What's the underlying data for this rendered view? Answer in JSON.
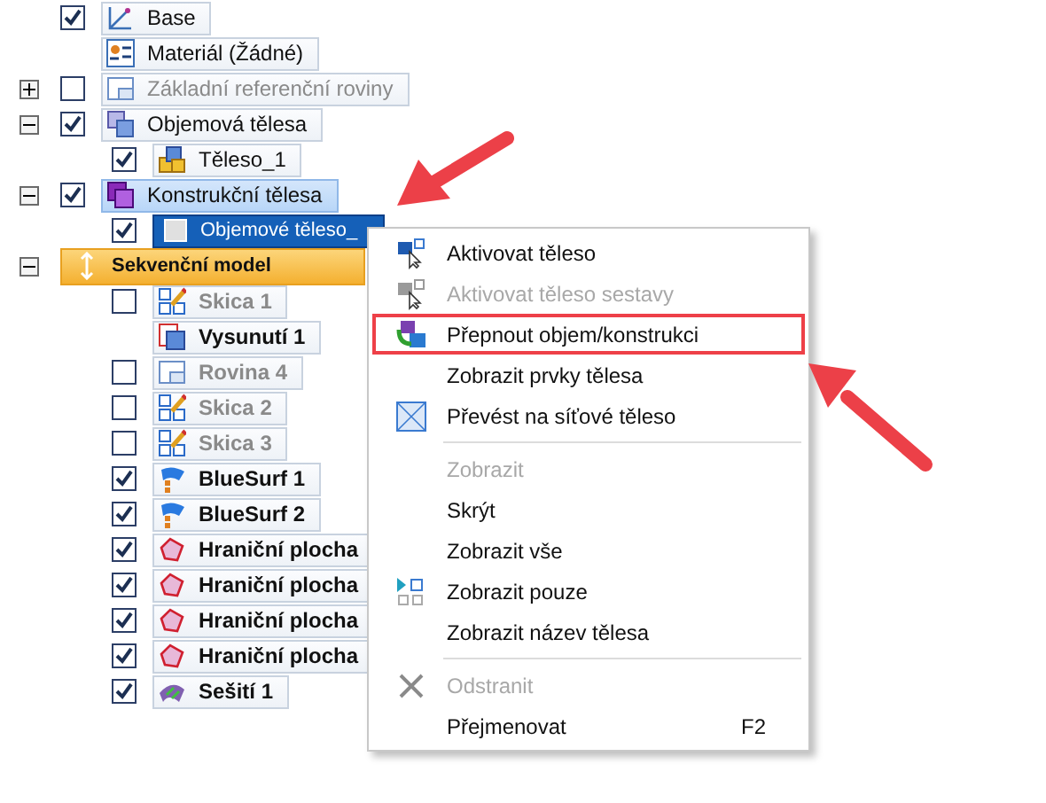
{
  "tree": [
    {
      "label": "Base",
      "kind": "coordinate",
      "checked": true,
      "selected": false,
      "hover": false,
      "disabled": false
    },
    {
      "label": "Materiál (Žádné)",
      "kind": "material",
      "selected": false,
      "hover": false,
      "disabled": false
    },
    {
      "label": "Základní referenční roviny",
      "kind": "plane",
      "expanded": false,
      "checked": false,
      "selected": false,
      "hover": false,
      "disabled": true
    },
    {
      "label": "Objemová tělesa",
      "kind": "bodies",
      "expanded": true,
      "checked": true,
      "selected": false,
      "hover": false,
      "disabled": false,
      "children": [
        {
          "label": "Těleso_1",
          "kind": "body",
          "checked": true,
          "selected": false,
          "hover": false,
          "disabled": false
        }
      ]
    },
    {
      "label": "Konstrukční tělesa",
      "kind": "construction",
      "expanded": true,
      "checked": true,
      "selected": false,
      "hover": true,
      "disabled": false,
      "children": [
        {
          "label": "Objemové těleso_",
          "kind": "solid",
          "checked": true,
          "selected": true,
          "hover": false,
          "disabled": false
        }
      ]
    },
    {
      "label": "Sekvenční model",
      "kind": "section",
      "expanded": true,
      "selected": false,
      "hover": false,
      "disabled": false,
      "children": [
        {
          "label": "Skica 1",
          "kind": "sketch",
          "checked": false,
          "selected": false,
          "hover": false,
          "disabled": true
        },
        {
          "label": "Vysunutí 1",
          "kind": "extrude",
          "selected": false,
          "hover": false,
          "disabled": false
        },
        {
          "label": "Rovina 4",
          "kind": "plane",
          "checked": false,
          "selected": false,
          "hover": false,
          "disabled": true
        },
        {
          "label": "Skica 2",
          "kind": "sketch",
          "checked": false,
          "selected": false,
          "hover": false,
          "disabled": true
        },
        {
          "label": "Skica 3",
          "kind": "sketch",
          "checked": false,
          "selected": false,
          "hover": false,
          "disabled": true
        },
        {
          "label": "BlueSurf 1",
          "kind": "surface",
          "checked": true,
          "selected": false,
          "hover": false,
          "disabled": false
        },
        {
          "label": "BlueSurf 2",
          "kind": "surface",
          "checked": true,
          "selected": false,
          "hover": false,
          "disabled": false
        },
        {
          "label": "Hraniční plocha",
          "kind": "boundary",
          "checked": true,
          "selected": false,
          "hover": false,
          "disabled": false
        },
        {
          "label": "Hraniční plocha",
          "kind": "boundary",
          "checked": true,
          "selected": false,
          "hover": false,
          "disabled": false
        },
        {
          "label": "Hraniční plocha",
          "kind": "boundary",
          "checked": true,
          "selected": false,
          "hover": false,
          "disabled": false
        },
        {
          "label": "Hraniční plocha",
          "kind": "boundary",
          "checked": true,
          "selected": false,
          "hover": false,
          "disabled": false
        },
        {
          "label": "Sešití 1",
          "kind": "stitch",
          "checked": true,
          "selected": false,
          "hover": false,
          "disabled": false
        }
      ]
    }
  ],
  "context_menu": [
    {
      "kind": "activate",
      "label": "Aktivovat těleso",
      "disabled": false,
      "highlighted": false
    },
    {
      "kind": "activate",
      "label": "Aktivovat těleso sestavy",
      "disabled": true,
      "highlighted": false
    },
    {
      "kind": "toggle",
      "label": "Přepnout objem/konstrukci",
      "disabled": false,
      "highlighted": true
    },
    {
      "kind": "plain",
      "label": "Zobrazit prvky tělesa",
      "disabled": false,
      "highlighted": false
    },
    {
      "kind": "mesh",
      "label": "Převést na síťové těleso",
      "disabled": false,
      "highlighted": false
    },
    {
      "kind": "separator"
    },
    {
      "kind": "plain",
      "label": "Zobrazit",
      "disabled": true,
      "highlighted": false
    },
    {
      "kind": "plain",
      "label": "Skrýt",
      "disabled": false,
      "highlighted": false
    },
    {
      "kind": "plain",
      "label": "Zobrazit vše",
      "disabled": false,
      "highlighted": false
    },
    {
      "kind": "show-only",
      "label": "Zobrazit pouze",
      "disabled": false,
      "highlighted": false
    },
    {
      "kind": "plain",
      "label": "Zobrazit název tělesa",
      "disabled": false,
      "highlighted": false
    },
    {
      "kind": "separator"
    },
    {
      "kind": "delete",
      "label": "Odstranit",
      "disabled": true,
      "highlighted": false
    },
    {
      "kind": "plain",
      "label": "Přejmenovat",
      "shortcut": "F2",
      "disabled": false,
      "highlighted": false
    }
  ]
}
